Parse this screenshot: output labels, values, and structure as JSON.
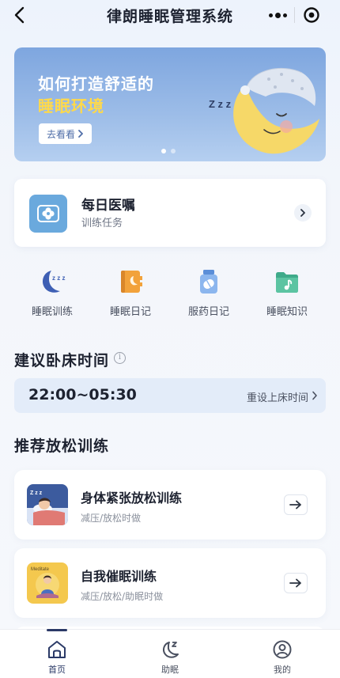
{
  "app": {
    "title": "律朗睡眠管理系统"
  },
  "banner": {
    "line1": "如何打造舒适的",
    "line2": "睡眠环境",
    "button_label": "去看看",
    "art_text": "Z z z",
    "slides": 2,
    "active_slide": 1,
    "colors": {
      "line1": "#ffffff",
      "line2": "#ffd94a"
    }
  },
  "daily": {
    "title": "每日医嘱",
    "subtitle": "训练任务",
    "icon": "flower-icon"
  },
  "quick": [
    {
      "label": "睡眠训练",
      "icon": "moon-zzz-icon"
    },
    {
      "label": "睡眠日记",
      "icon": "notebook-moon-icon"
    },
    {
      "label": "服药日记",
      "icon": "medicine-bottle-icon"
    },
    {
      "label": "睡眠知识",
      "icon": "music-folder-icon"
    }
  ],
  "bedtime": {
    "title": "建议卧床时间",
    "info_icon_glyph": "i",
    "value": "22:00~05:30",
    "reset_label": "重设上床时间"
  },
  "relax": {
    "title": "推荐放松训练",
    "items": [
      {
        "title": "身体紧张放松训练",
        "subtitle": "减压/放松时做",
        "art_text": "Z z z"
      },
      {
        "title": "自我催眠训练",
        "subtitle": "减压/放松/助眠时做",
        "art_text": "Meditate"
      }
    ]
  },
  "tabbar": {
    "items": [
      {
        "label": "首页",
        "icon": "home-icon",
        "active": true
      },
      {
        "label": "助眠",
        "icon": "moon-z-icon",
        "active": false
      },
      {
        "label": "我的",
        "icon": "user-icon",
        "active": false
      }
    ]
  },
  "colors": {
    "accent": "#2b3a67",
    "banner_bg": "#8fb3e4",
    "bedtime_bg": "#e3ecf9"
  }
}
